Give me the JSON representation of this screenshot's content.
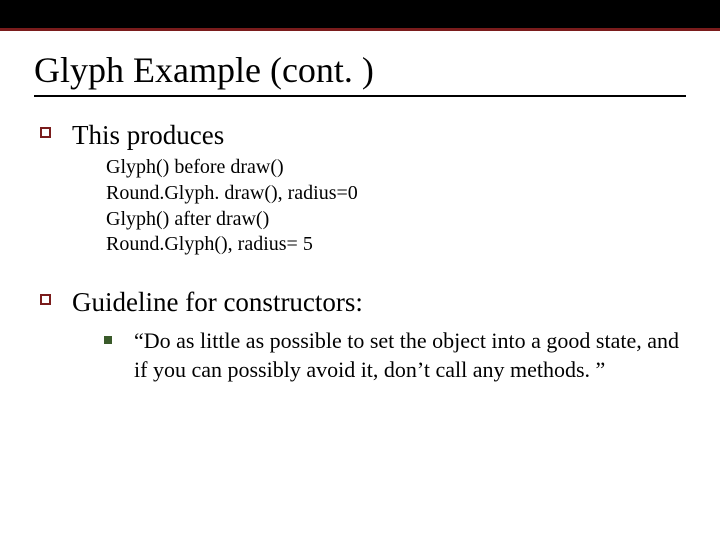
{
  "title": "Glyph Example (cont. )",
  "bullets": {
    "produces": {
      "heading": "This produces",
      "lines": {
        "l1": "Glyph() before draw()",
        "l2": "Round.Glyph. draw(), radius=0",
        "l3": "Glyph() after draw()",
        "l4": "Round.Glyph(), radius= 5"
      }
    },
    "guideline": {
      "heading": "Guideline for constructors:",
      "quote": "“Do as little as possible to set the object into a good state, and if you can possibly avoid it, don’t call any methods. ”"
    }
  }
}
